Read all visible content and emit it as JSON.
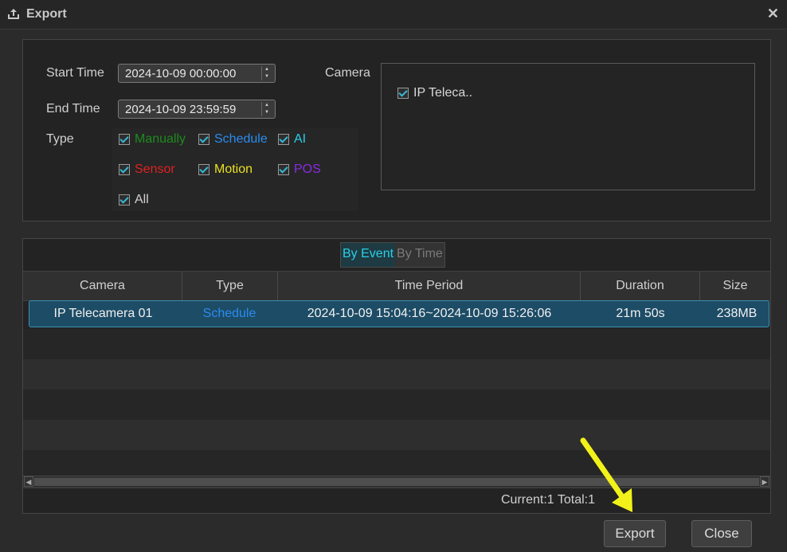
{
  "window": {
    "title": "Export"
  },
  "filters": {
    "start_time_label": "Start Time",
    "start_time_value": "2024-10-09 00:00:00",
    "end_time_label": "End Time",
    "end_time_value": "2024-10-09 23:59:59",
    "type_label": "Type",
    "types": [
      {
        "label": "Manually",
        "color": "#1e8b1e",
        "checked": true
      },
      {
        "label": "Schedule",
        "color": "#2a8cf0",
        "checked": true
      },
      {
        "label": "AI",
        "color": "#2ad0e6",
        "checked": true
      },
      {
        "label": "Sensor",
        "color": "#e02020",
        "checked": true
      },
      {
        "label": "Motion",
        "color": "#e8e020",
        "checked": true
      },
      {
        "label": "POS",
        "color": "#8a2be2",
        "checked": true
      },
      {
        "label": "All",
        "color": "#d0d0d0",
        "checked": true
      }
    ],
    "camera_label": "Camera",
    "cameras": [
      {
        "label": "IP Teleca..",
        "checked": true
      }
    ]
  },
  "tabs": [
    {
      "label": "By Event",
      "active": true
    },
    {
      "label": "By Time",
      "active": false
    }
  ],
  "table": {
    "headers": [
      "Camera",
      "Type",
      "Time Period",
      "Duration",
      "Size"
    ],
    "rows": [
      {
        "camera": "IP Telecamera 01",
        "type": "Schedule",
        "type_color": "#2a8cf0",
        "period": "2024-10-09 15:04:16~2024-10-09 15:26:06",
        "duration": "21m 50s",
        "size": "238MB",
        "selected": true
      }
    ]
  },
  "status": {
    "text": "Current:1 Total:1"
  },
  "buttons": {
    "export": "Export",
    "close": "Close"
  },
  "colors": {
    "accent": "#2ad0e6",
    "selection": "#1d4c66",
    "annotation_arrow": "#f2f21a"
  },
  "icons": {
    "title": "export-icon",
    "close": "close-icon"
  }
}
